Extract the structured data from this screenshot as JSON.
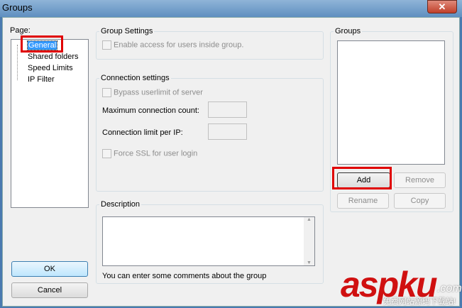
{
  "window": {
    "title": "Groups",
    "close": "✕"
  },
  "page_panel": {
    "label": "Page:",
    "items": [
      "General",
      "Shared folders",
      "Speed Limits",
      "IP Filter"
    ],
    "selected": "General"
  },
  "group_settings": {
    "title": "Group Settings",
    "enable_access": "Enable access for users inside group."
  },
  "connection_settings": {
    "title": "Connection settings",
    "bypass": "Bypass userlimit of server",
    "max_count_label": "Maximum connection count:",
    "max_count_value": "",
    "limit_per_ip_label": "Connection limit per IP:",
    "limit_per_ip_value": "",
    "force_ssl": "Force SSL for user login"
  },
  "description": {
    "title": "Description",
    "value": "",
    "hint": "You can enter some comments about the group"
  },
  "groups": {
    "title": "Groups",
    "add": "Add",
    "remove": "Remove",
    "rename": "Rename",
    "copy": "Copy"
  },
  "buttons": {
    "ok": "OK",
    "cancel": "Cancel"
  },
  "watermark": {
    "brand": "aspku",
    "domain": ".com",
    "tagline": "免费网站源码下载站!"
  }
}
